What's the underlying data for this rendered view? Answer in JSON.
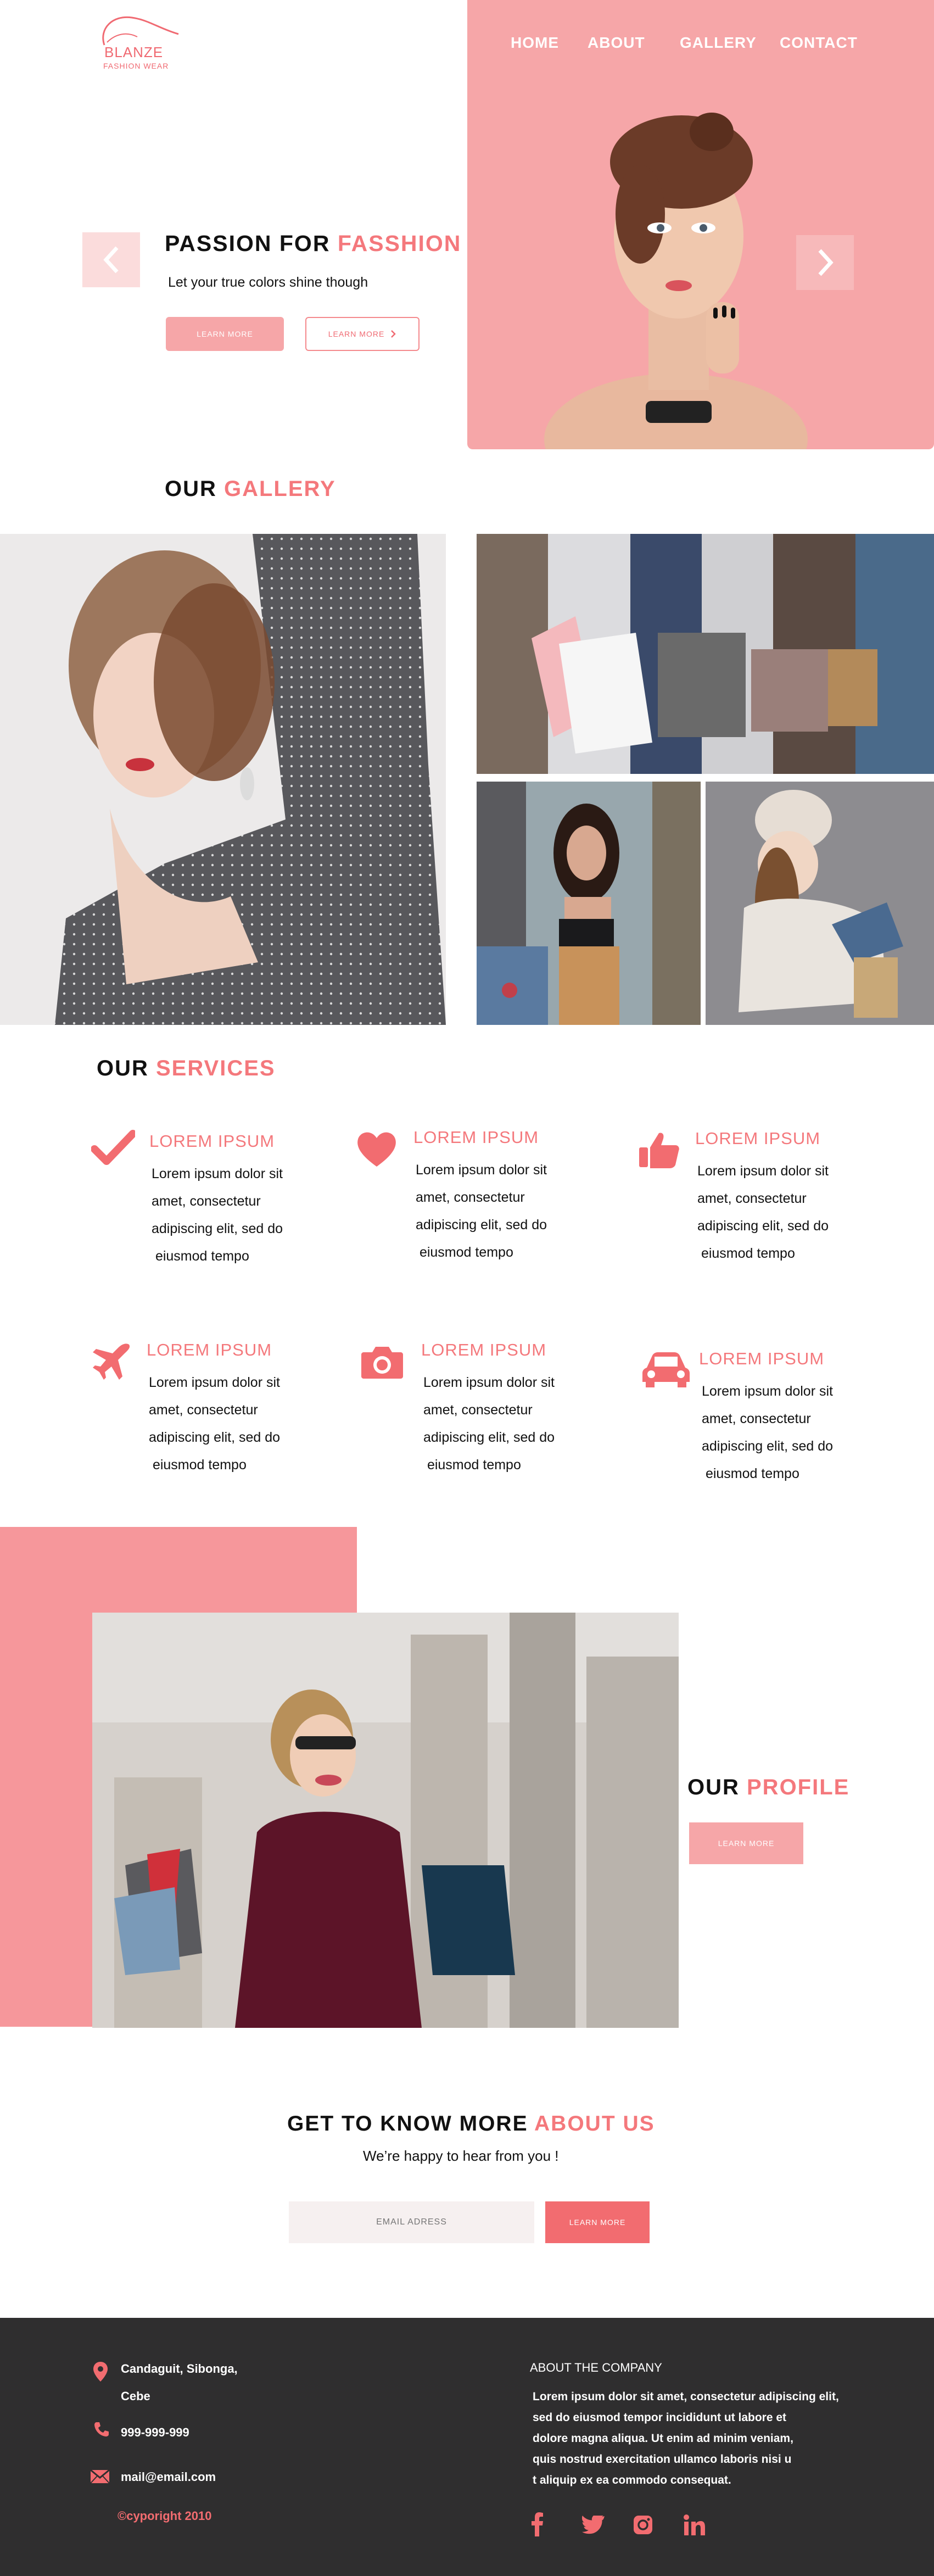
{
  "header": {
    "brand": "BLANZE",
    "brand_sub": "FASHION WEAR",
    "nav": [
      "HOME",
      "ABOUT",
      "GALLERY",
      "CONTACT"
    ]
  },
  "hero": {
    "title_plain": "PASSION FOR ",
    "title_accent": "FASSHION",
    "subtitle": "Let your true colors shine though",
    "btn_primary": "LEARN MORE",
    "btn_secondary": "LEARN MORE"
  },
  "gallery": {
    "title_plain": "OUR ",
    "title_accent": "GALLERY"
  },
  "services": {
    "title_plain": "OUR ",
    "title_accent": "SERVICES",
    "items": [
      {
        "icon": "check-icon",
        "title": "LOREM IPSUM",
        "l1": "Lorem ipsum dolor sit",
        "l2": "amet,  consectetur",
        "l3": "adipiscing elit, sed do",
        "l4": " eiusmod tempo"
      },
      {
        "icon": "heart-icon",
        "title": "LOREM IPSUM",
        "l1": "Lorem ipsum dolor sit",
        "l2": "amet,  consectetur",
        "l3": "adipiscing elit, sed do",
        "l4": " eiusmod tempo"
      },
      {
        "icon": "thumbs-up-icon",
        "title": "LOREM IPSUM",
        "l1": "Lorem ipsum dolor sit",
        "l2": "amet,  consectetur",
        "l3": "adipiscing elit, sed do",
        "l4": " eiusmod tempo"
      },
      {
        "icon": "airplane-icon",
        "title": "LOREM IPSUM",
        "l1": "Lorem ipsum dolor sit",
        "l2": "amet,  consectetur",
        "l3": "adipiscing elit, sed do",
        "l4": " eiusmod tempo"
      },
      {
        "icon": "camera-icon",
        "title": "LOREM IPSUM",
        "l1": "Lorem ipsum dolor sit",
        "l2": "amet,  consectetur",
        "l3": "adipiscing elit, sed do",
        "l4": " eiusmod tempo"
      },
      {
        "icon": "car-icon",
        "title": "LOREM IPSUM",
        "l1": "Lorem ipsum dolor sit",
        "l2": "amet,  consectetur",
        "l3": "adipiscing elit, sed do",
        "l4": " eiusmod tempo"
      }
    ]
  },
  "profile": {
    "title_plain": "OUR ",
    "title_accent": "PROFILE",
    "btn": "LEARN MORE"
  },
  "about": {
    "title_plain": "GET TO KNOW MORE ",
    "title_accent": "ABOUT US",
    "subtitle": "We’re happy to hear from you !",
    "email_placeholder": "EMAIL ADRESS",
    "btn": "LEARN MORE"
  },
  "footer": {
    "address_l1": "Candaguit, Sibonga,",
    "address_l2": "Cebe",
    "phone": "999-999-999",
    "email": "mail@email.com",
    "copyright": "©cyporight 2010",
    "about_title": "ABOUT THE COMPANY",
    "about_l1": "Lorem ipsum dolor sit amet, consectetur adipiscing elit,",
    "about_l2": "sed do eiusmod tempor incididunt ut labore et",
    "about_l3": "dolore magna aliqua. Ut enim ad minim veniam,",
    "about_l4": "quis nostrud exercitation ullamco laboris nisi u",
    "about_l5": "t aliquip ex ea commodo consequat.",
    "social": [
      "facebook-icon",
      "twitter-icon",
      "instagram-icon",
      "linkedin-icon"
    ]
  },
  "colors": {
    "accent": "#f4787c",
    "hero_panel": "#f6a6a8",
    "footer_bg": "#2f2e2f"
  }
}
